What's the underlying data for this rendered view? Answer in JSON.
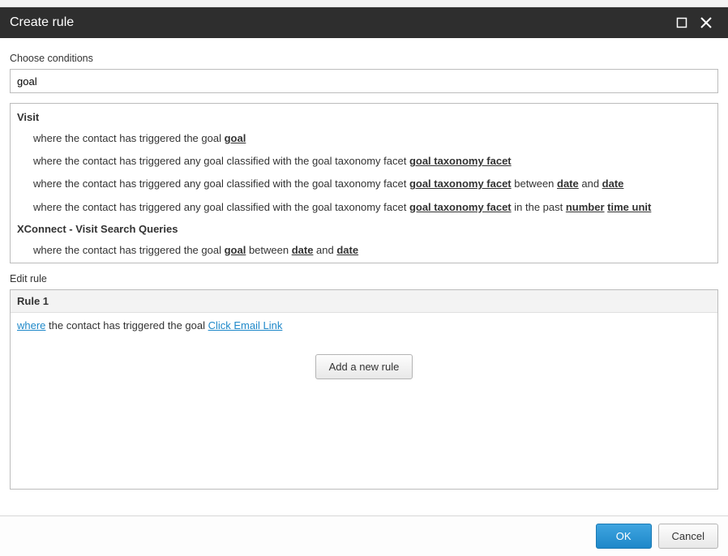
{
  "titlebar": {
    "title": "Create rule"
  },
  "labels": {
    "choose_conditions": "Choose conditions",
    "edit_rule": "Edit rule"
  },
  "search": {
    "value": "goal",
    "placeholder": ""
  },
  "conditions": {
    "groups": [
      {
        "name": "Visit",
        "items": [
          {
            "prefix": "where the contact has triggered the goal ",
            "tokens": [
              {
                "t": "goal"
              }
            ]
          },
          {
            "prefix": "where the contact has triggered any goal classified with the goal taxonomy facet ",
            "tokens": [
              {
                "t": "goal taxonomy facet"
              }
            ]
          },
          {
            "prefix": "where the contact has triggered any goal classified with the goal taxonomy facet ",
            "tokens": [
              {
                "t": "goal taxonomy facet"
              },
              {
                "text": " between "
              },
              {
                "t": "date"
              },
              {
                "text": " and "
              },
              {
                "t": "date"
              }
            ]
          },
          {
            "prefix": "where the contact has triggered any goal classified with the goal taxonomy facet ",
            "tokens": [
              {
                "t": "goal taxonomy facet"
              },
              {
                "text": " in the past "
              },
              {
                "t": "number"
              },
              {
                "text": " "
              },
              {
                "t": "time unit"
              }
            ]
          }
        ]
      },
      {
        "name": "XConnect - Visit Search Queries",
        "items": [
          {
            "prefix": "where the contact has triggered the goal ",
            "tokens": [
              {
                "t": "goal"
              },
              {
                "text": " between "
              },
              {
                "t": "date"
              },
              {
                "text": " and "
              },
              {
                "t": "date"
              }
            ]
          }
        ]
      }
    ]
  },
  "rule": {
    "header": "Rule 1",
    "where_label": "where",
    "mid_text": " the contact has triggered the goal ",
    "goal_value": "Click Email Link"
  },
  "buttons": {
    "add_rule": "Add a new rule",
    "ok": "OK",
    "cancel": "Cancel"
  }
}
